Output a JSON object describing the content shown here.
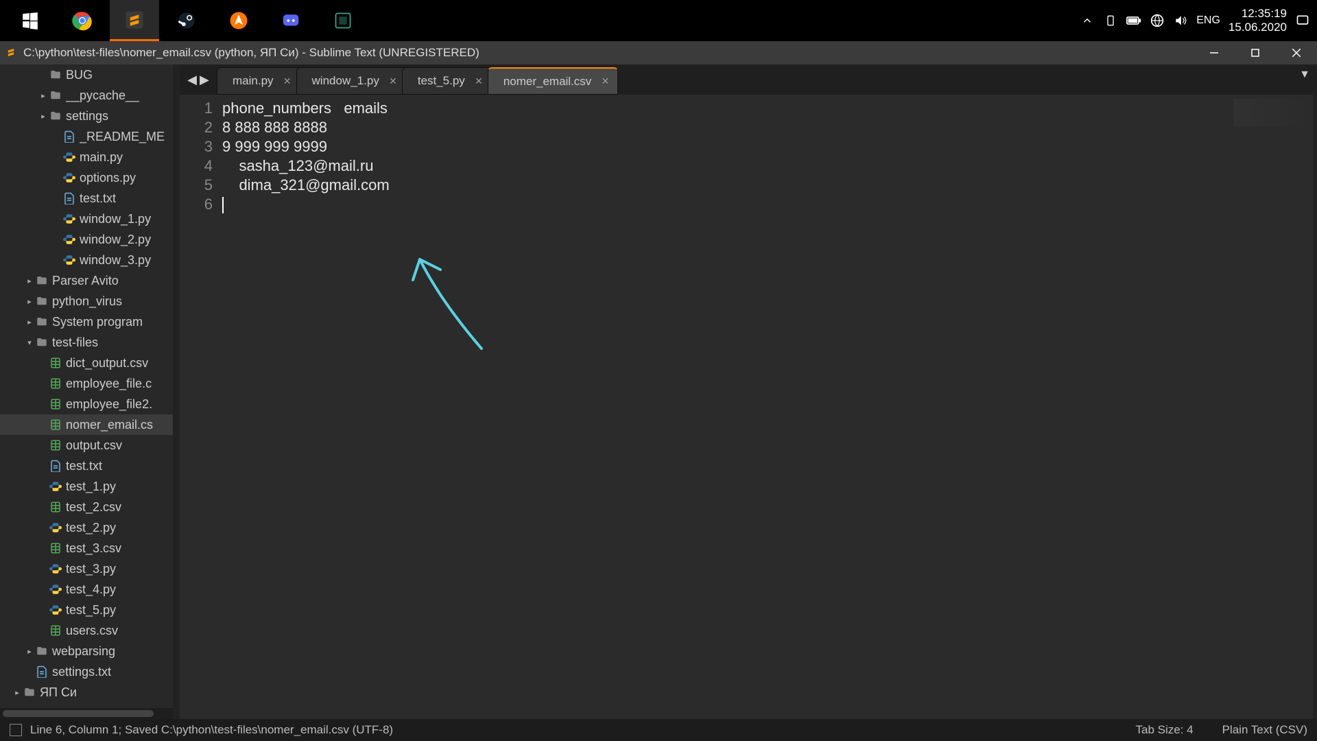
{
  "taskbar": {
    "tray_lang": "ENG",
    "time": "12:35:19",
    "date": "15.06.2020"
  },
  "titlebar": {
    "text": "C:\\python\\test-files\\nomer_email.csv (python, ЯП Си) - Sublime Text (UNREGISTERED)"
  },
  "sidebar": {
    "items": [
      {
        "ind": "ind1",
        "arrow": "",
        "type": "folder",
        "label": "BUG"
      },
      {
        "ind": "ind1",
        "arrow": "▸",
        "type": "folder",
        "label": "__pycache__"
      },
      {
        "ind": "ind1",
        "arrow": "▸",
        "type": "folder",
        "label": "settings"
      },
      {
        "ind": "ind2",
        "arrow": "",
        "type": "txt",
        "label": "_README_ME"
      },
      {
        "ind": "ind2",
        "arrow": "",
        "type": "py",
        "label": "main.py"
      },
      {
        "ind": "ind2",
        "arrow": "",
        "type": "py",
        "label": "options.py"
      },
      {
        "ind": "ind2",
        "arrow": "",
        "type": "txt",
        "label": "test.txt"
      },
      {
        "ind": "ind2",
        "arrow": "",
        "type": "py",
        "label": "window_1.py"
      },
      {
        "ind": "ind2",
        "arrow": "",
        "type": "py",
        "label": "window_2.py"
      },
      {
        "ind": "ind2",
        "arrow": "",
        "type": "py",
        "label": "window_3.py"
      },
      {
        "ind": "ind0",
        "arrow": "▸",
        "type": "folder",
        "label": "Parser Avito"
      },
      {
        "ind": "ind0",
        "arrow": "▸",
        "type": "folder",
        "label": "python_virus"
      },
      {
        "ind": "ind0",
        "arrow": "▸",
        "type": "folder",
        "label": "System program"
      },
      {
        "ind": "indB",
        "arrow": "▾",
        "type": "folder",
        "label": "test-files"
      },
      {
        "ind": "ind1",
        "arrow": "",
        "type": "csv",
        "label": "dict_output.csv"
      },
      {
        "ind": "ind1",
        "arrow": "",
        "type": "csv",
        "label": "employee_file.c"
      },
      {
        "ind": "ind1",
        "arrow": "",
        "type": "csv",
        "label": "employee_file2."
      },
      {
        "ind": "ind1",
        "arrow": "",
        "type": "csv",
        "label": "nomer_email.cs",
        "selected": true
      },
      {
        "ind": "ind1",
        "arrow": "",
        "type": "csv",
        "label": "output.csv"
      },
      {
        "ind": "ind1",
        "arrow": "",
        "type": "txt",
        "label": "test.txt"
      },
      {
        "ind": "ind1",
        "arrow": "",
        "type": "py",
        "label": "test_1.py"
      },
      {
        "ind": "ind1",
        "arrow": "",
        "type": "csv",
        "label": "test_2.csv"
      },
      {
        "ind": "ind1",
        "arrow": "",
        "type": "py",
        "label": "test_2.py"
      },
      {
        "ind": "ind1",
        "arrow": "",
        "type": "csv",
        "label": "test_3.csv"
      },
      {
        "ind": "ind1",
        "arrow": "",
        "type": "py",
        "label": "test_3.py"
      },
      {
        "ind": "ind1",
        "arrow": "",
        "type": "py",
        "label": "test_4.py"
      },
      {
        "ind": "ind1",
        "arrow": "",
        "type": "py",
        "label": "test_5.py"
      },
      {
        "ind": "ind1",
        "arrow": "",
        "type": "csv",
        "label": "users.csv"
      },
      {
        "ind": "indB",
        "arrow": "▸",
        "type": "folder",
        "label": "webparsing"
      },
      {
        "ind": "indB",
        "arrow": "",
        "type": "txt",
        "label": "settings.txt"
      },
      {
        "ind": "indA",
        "arrow": "▸",
        "type": "folder",
        "label": "ЯП Си"
      }
    ]
  },
  "tabs": [
    {
      "label": "main.py",
      "active": false
    },
    {
      "label": "window_1.py",
      "active": false
    },
    {
      "label": "test_5.py",
      "active": false
    },
    {
      "label": "nomer_email.csv",
      "active": true
    }
  ],
  "editor": {
    "lines": [
      "phone_numbers   emails",
      "8 888 888 8888",
      "9 999 999 9999",
      "    sasha_123@mail.ru",
      "    dima_321@gmail.com",
      ""
    ]
  },
  "statusbar": {
    "left": "Line 6, Column 1; Saved C:\\python\\test-files\\nomer_email.csv (UTF-8)",
    "tab_size": "Tab Size: 4",
    "syntax": "Plain Text (CSV)"
  }
}
